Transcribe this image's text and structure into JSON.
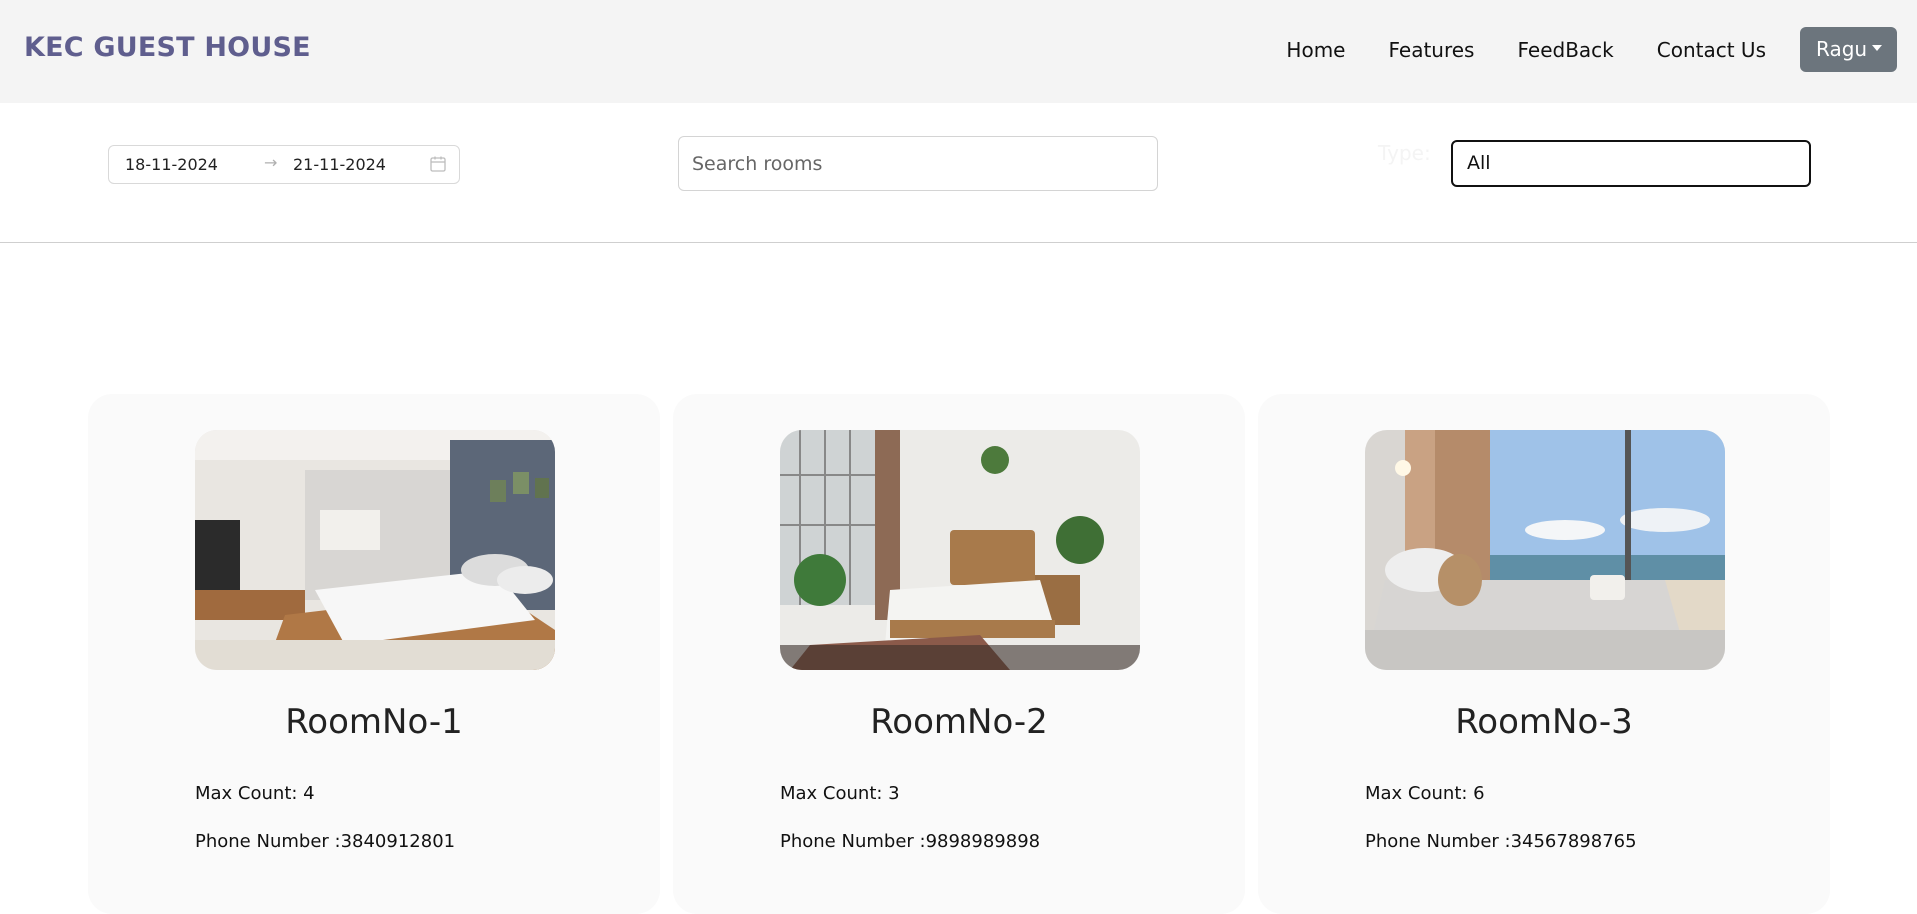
{
  "brand": "KEC GUEST HOUSE",
  "nav": {
    "items": [
      "Home",
      "Features",
      "FeedBack",
      "Contact Us"
    ],
    "user": "Ragu"
  },
  "filters": {
    "date_start": "18-11-2024",
    "date_end": "21-11-2024",
    "search_placeholder": "Search rooms",
    "type_label": "Type:",
    "type_value": "All"
  },
  "rooms": [
    {
      "title": "RoomNo-1",
      "max_count": "Max Count: 4",
      "phone": "Phone Number :3840912801"
    },
    {
      "title": "RoomNo-2",
      "max_count": "Max Count: 3",
      "phone": "Phone Number :9898989898"
    },
    {
      "title": "RoomNo-3",
      "max_count": "Max Count: 6",
      "phone": "Phone Number :34567898765"
    }
  ],
  "colors": {
    "brand": "#5f5e8e",
    "navbar_bg": "#f4f4f4",
    "user_button": "#6c757d",
    "card_bg": "#fafafa"
  },
  "icons": [
    "calendar-icon",
    "arrow-right-icon",
    "caret-down-icon"
  ]
}
